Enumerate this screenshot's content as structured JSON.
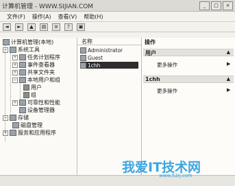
{
  "title_bar": {
    "title": "计算机管理 - WWW.SIJIAN.COM"
  },
  "menu": [
    "文件(F)",
    "操作(A)",
    "查看(V)",
    "帮助(H)"
  ],
  "tree": {
    "root": "计算机管理(本地)",
    "system_tools": "系统工具",
    "task_scheduler": "任务计划程序",
    "event_viewer": "事件查看器",
    "shared_folders": "共享文件夹",
    "local_users_groups": "本地用户和组",
    "users": "用户",
    "groups": "组",
    "reliability": "可靠性和性能",
    "device_manager": "设备管理器",
    "storage": "存储",
    "disk_management": "磁盘管理",
    "services_apps": "服务和应用程序"
  },
  "list": {
    "column": "名称",
    "users": [
      "Administrator",
      "Guest",
      "1chh"
    ],
    "selected_index": 2
  },
  "actions": {
    "title": "操作",
    "group1": "用户",
    "more1": "更多操作",
    "group2": "1chh",
    "more2": "更多操作"
  },
  "watermark": {
    "text": "我爱IT技术网",
    "url": "www.52ij.com"
  },
  "colors": {
    "selection": "#2d2d2d",
    "watermark": "#2e9ee0"
  }
}
